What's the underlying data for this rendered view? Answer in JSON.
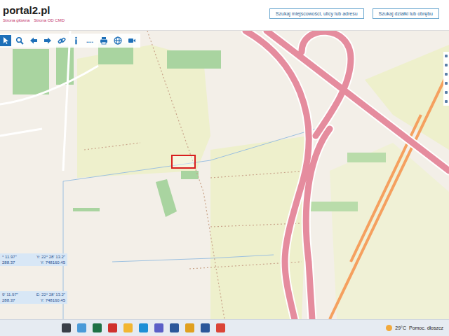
{
  "header": {
    "logo": "portal2.pl",
    "links": [
      "Strona główna",
      "Strona OD CMD"
    ],
    "search_buttons": [
      "Szukaj miejscowości, ulicy lub adresu",
      "Szukaj działki lub obrębu"
    ]
  },
  "toolbar": {
    "items": [
      {
        "kind": "cursor",
        "selected": true
      },
      {
        "kind": "zoom",
        "selected": false
      },
      {
        "kind": "back",
        "selected": false
      },
      {
        "kind": "forward",
        "selected": false
      },
      {
        "kind": "link",
        "selected": false
      },
      {
        "kind": "info",
        "selected": false
      },
      {
        "kind": "dots",
        "label": "....",
        "selected": false
      },
      {
        "kind": "print",
        "selected": false
      },
      {
        "kind": "globe",
        "selected": false
      },
      {
        "kind": "video",
        "selected": false
      }
    ]
  },
  "coordinates": [
    {
      "lat": "° 11.97\"",
      "lon": "Y: 22° 28' 13.2\"",
      "x": "288.37",
      "y": "Y: 748160.45"
    },
    {
      "lat": "9' 11.97\"",
      "lon": "E: 22° 28' 13.2\"",
      "x": "288.37",
      "y": "Y: 748160.45"
    }
  ],
  "taskbar": {
    "apps": [
      {
        "color": "#3a3f48"
      },
      {
        "color": "#4a9ad8"
      },
      {
        "color": "#1e7145"
      },
      {
        "color": "#d0312d"
      },
      {
        "color": "#f2b632"
      },
      {
        "color": "#1e8fd6"
      },
      {
        "color": "#5b5fc7"
      },
      {
        "color": "#2b579a"
      },
      {
        "color": "#e0a020"
      },
      {
        "color": "#2b579a"
      },
      {
        "color": "#db4437"
      }
    ],
    "weather": {
      "temp": "29°C",
      "text": "Pomoc. dłoszcz"
    }
  }
}
